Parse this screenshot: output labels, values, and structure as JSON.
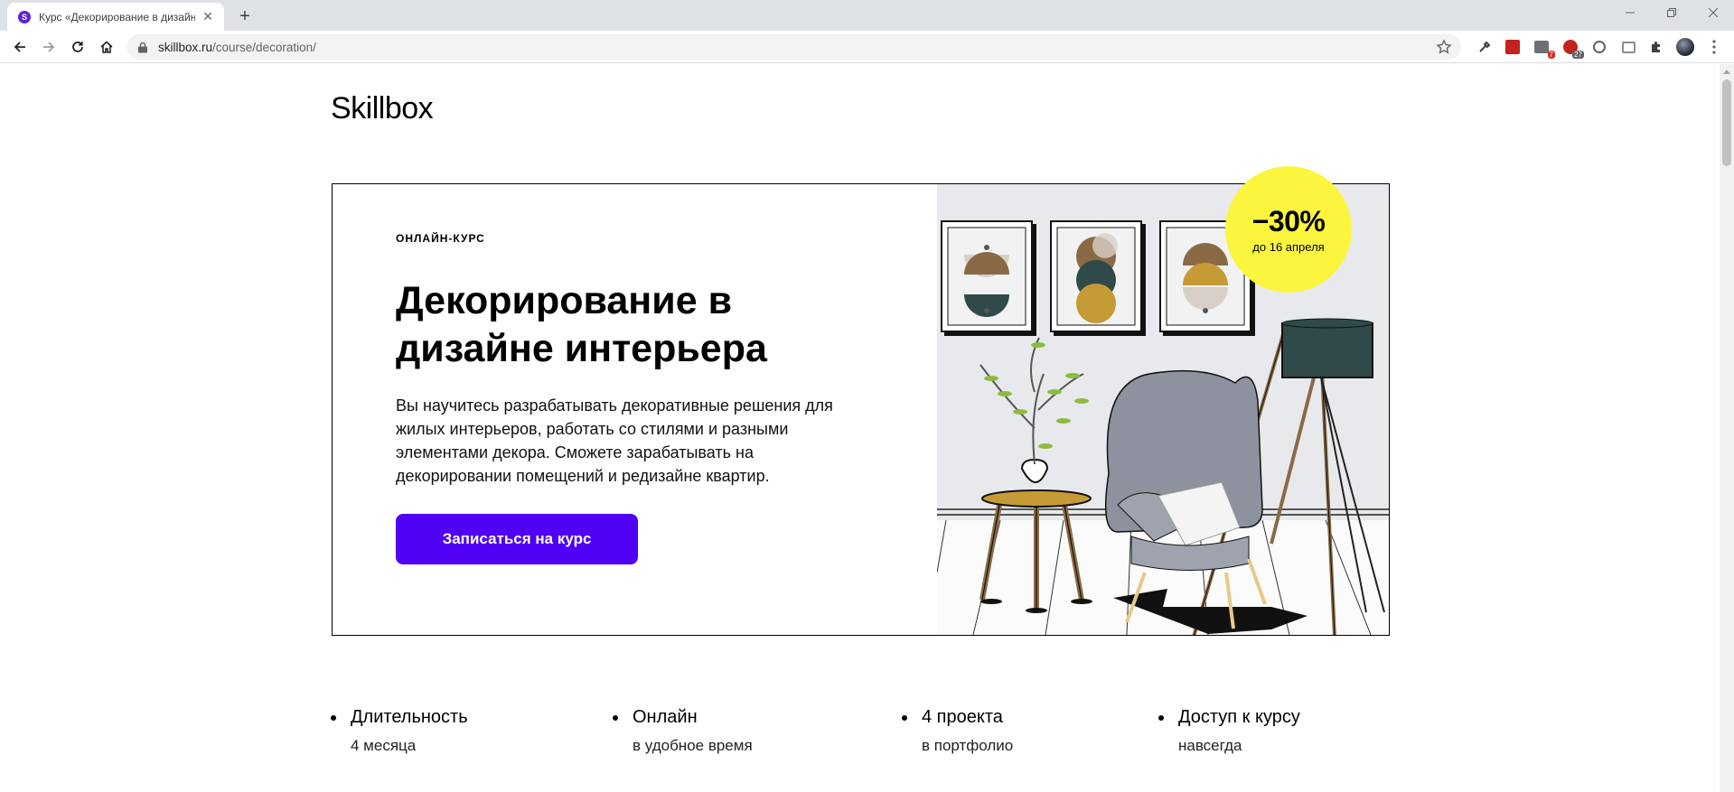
{
  "browser": {
    "tab_title": "Курс «Декорирование в дизайн",
    "tab_favicon_letter": "S",
    "url_host": "skillbox.ru",
    "url_path": "/course/decoration/",
    "extensions": [
      {
        "name": "eyedropper-icon"
      },
      {
        "name": "pdf-icon"
      },
      {
        "name": "extension-badge-icon",
        "badge": "7"
      },
      {
        "name": "adblock-icon",
        "badge": "27"
      },
      {
        "name": "circle-extension-icon"
      },
      {
        "name": "screenshot-icon"
      },
      {
        "name": "puzzle-extensions-icon"
      },
      {
        "name": "profile-avatar"
      }
    ]
  },
  "site": {
    "logo": "Skillbox"
  },
  "hero": {
    "kicker": "ОНЛАЙН-КУРС",
    "title": "Декорирование в дизайне интерьера",
    "description": "Вы научитесь разрабатывать декоративные решения для жилых интерьеров, работать со стилями и разными элементами декора. Сможете зарабатывать на декорировании помещений и редизайне квартир.",
    "cta_label": "Записаться на курс",
    "accent_color": "#4f00f5"
  },
  "sale": {
    "percent": "−30%",
    "until": "до 16 апреля",
    "color": "#fbf63d"
  },
  "features": [
    {
      "title": "Длительность",
      "subtitle": "4 месяца"
    },
    {
      "title": "Онлайн",
      "subtitle": "в удобное время"
    },
    {
      "title": "4 проекта",
      "subtitle": "в портфолио"
    },
    {
      "title": "Доступ к курсу",
      "subtitle": "навсегда"
    }
  ]
}
